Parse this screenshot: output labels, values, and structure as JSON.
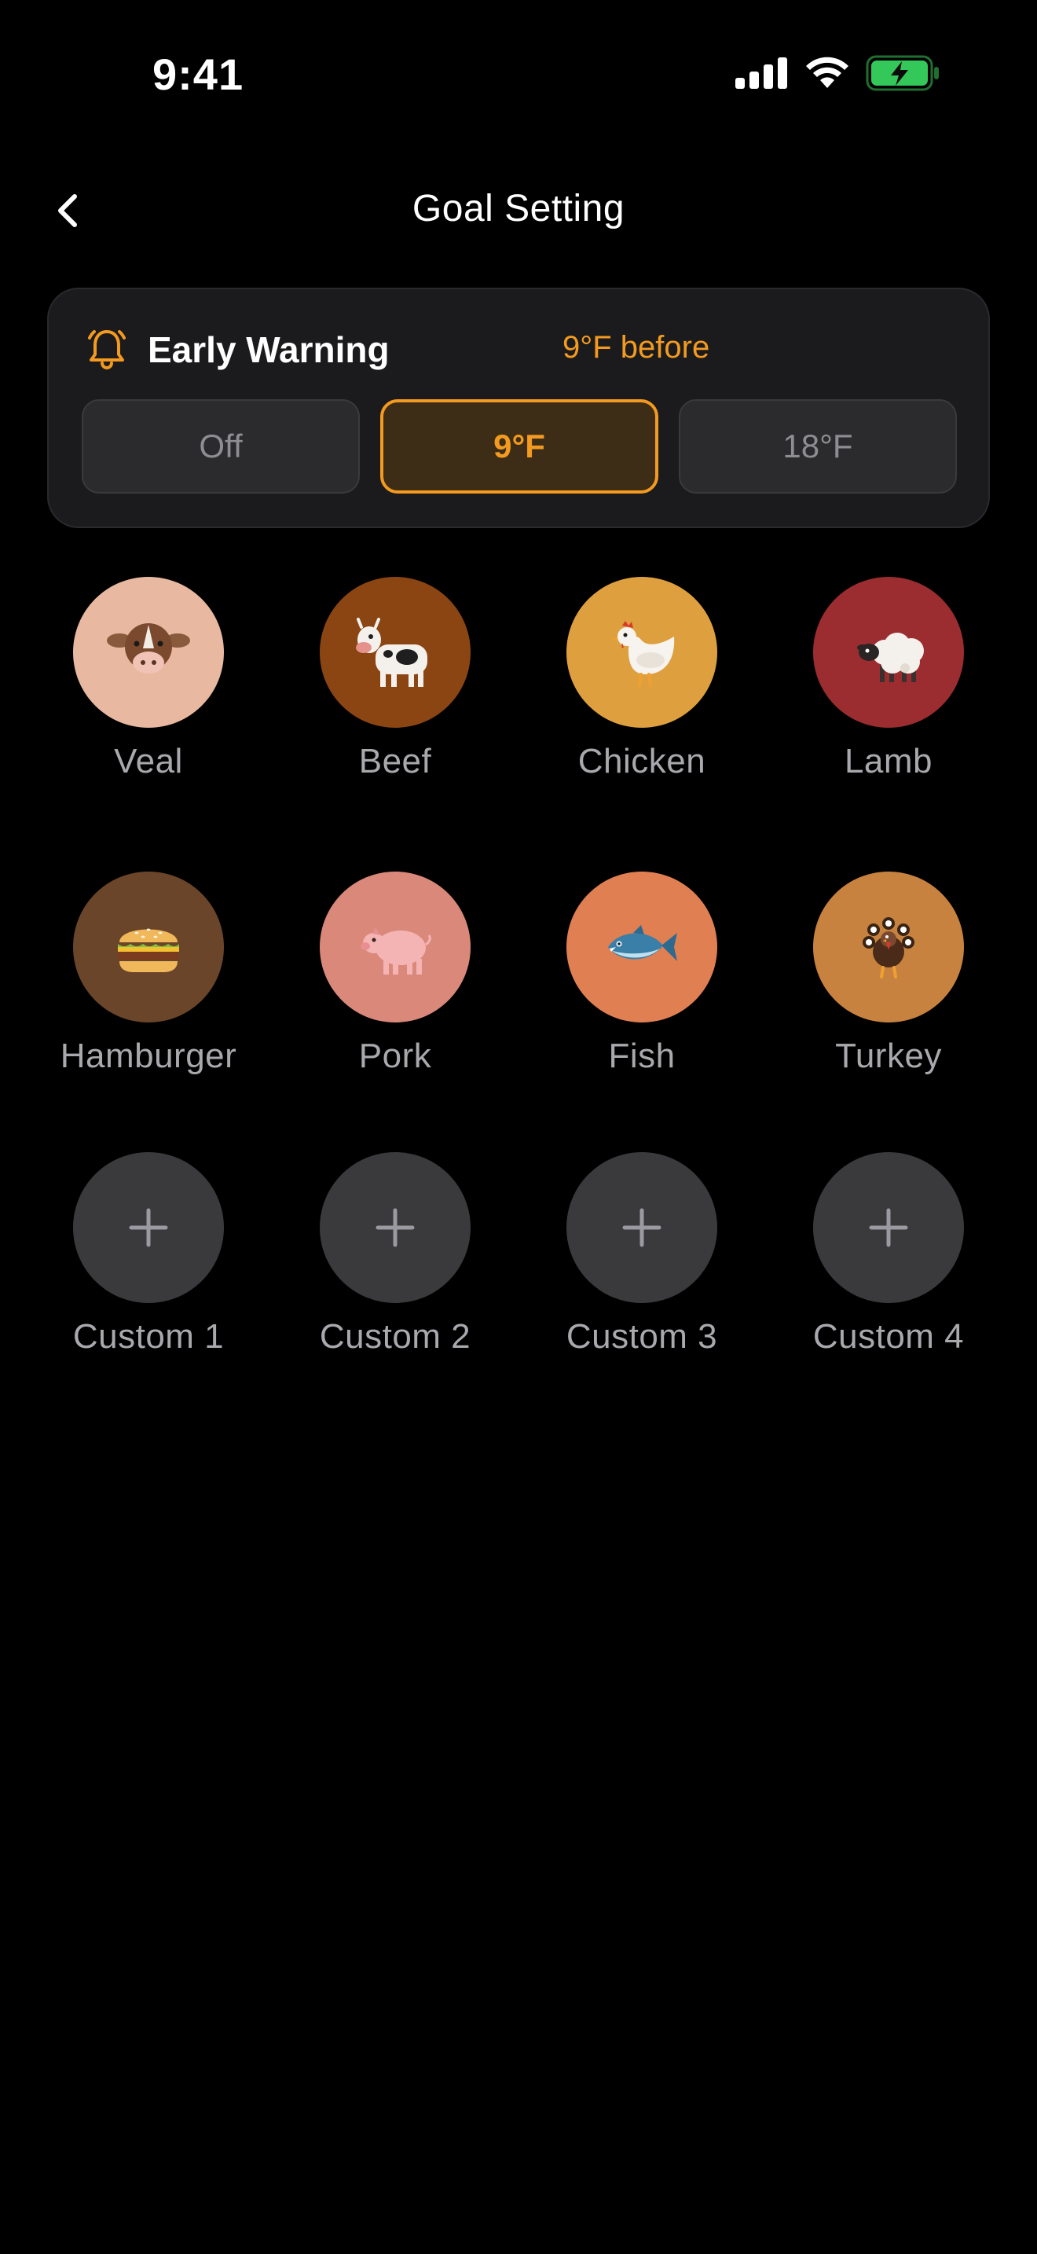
{
  "status_bar": {
    "time": "9:41",
    "icons": [
      "signal-icon",
      "wifi-icon",
      "battery-charging-icon"
    ]
  },
  "nav": {
    "title": "Goal Setting",
    "back_icon": "chevron-left-icon"
  },
  "early_warning": {
    "icon": "bell-icon",
    "title": "Early Warning",
    "value_text": "9°F before",
    "options": [
      "Off",
      "9°F",
      "18°F"
    ],
    "selected": "9°F",
    "accent": "#f39a20"
  },
  "presets": [
    {
      "label": "Veal",
      "icon": "veal-icon",
      "color": "#e8b9a0"
    },
    {
      "label": "Beef",
      "icon": "cow-icon",
      "color": "#8b4513"
    },
    {
      "label": "Chicken",
      "icon": "chicken-icon",
      "color": "#dea03f"
    },
    {
      "label": "Lamb",
      "icon": "sheep-icon",
      "color": "#9b2d30"
    },
    {
      "label": "Hamburger",
      "icon": "hamburger-icon",
      "color": "#6b4529"
    },
    {
      "label": "Pork",
      "icon": "pig-icon",
      "color": "#d9887a"
    },
    {
      "label": "Fish",
      "icon": "fish-icon",
      "color": "#e07f52"
    },
    {
      "label": "Turkey",
      "icon": "turkey-icon",
      "color": "#c8823f"
    },
    {
      "label": "Custom 1",
      "icon": "plus-icon",
      "color": "#3a3a3c"
    },
    {
      "label": "Custom 2",
      "icon": "plus-icon",
      "color": "#3a3a3c"
    },
    {
      "label": "Custom 3",
      "icon": "plus-icon",
      "color": "#3a3a3c"
    },
    {
      "label": "Custom 4",
      "icon": "plus-icon",
      "color": "#3a3a3c"
    }
  ]
}
